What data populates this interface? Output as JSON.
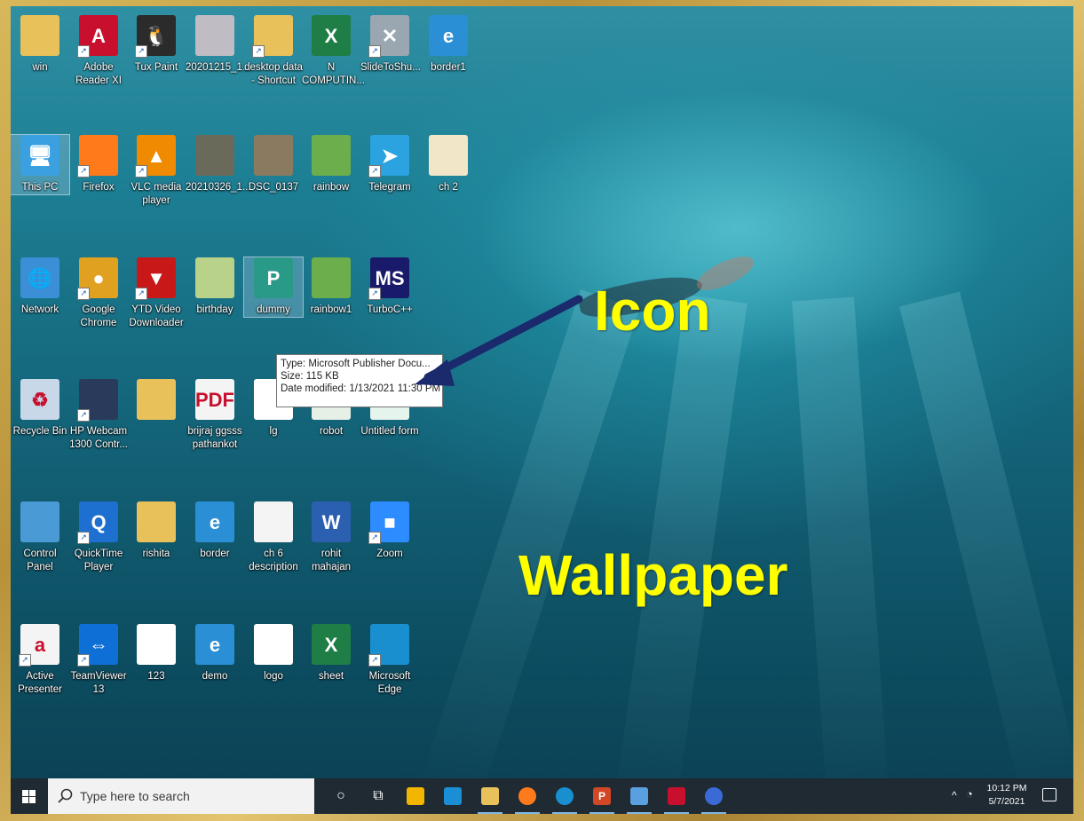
{
  "desktop": {
    "rows": [
      [
        {
          "name": "win-folder",
          "label": "win",
          "color": "#e8c15b",
          "glyph": "",
          "shortcut": false
        },
        {
          "name": "adobe-reader-xi",
          "label": "Adobe Reader XI",
          "color": "#c8102e",
          "glyph": "A",
          "shortcut": true
        },
        {
          "name": "tux-paint",
          "label": "Tux Paint",
          "color": "#2b2b2b",
          "glyph": "🐧",
          "shortcut": true
        },
        {
          "name": "image-20201215",
          "label": "20201215_1...",
          "color": "#bfbcc4",
          "glyph": "",
          "shortcut": false
        },
        {
          "name": "desktop-data-shortcut",
          "label": "desktop data - Shortcut",
          "color": "#e8c15b",
          "glyph": "",
          "shortcut": true
        },
        {
          "name": "n-computing",
          "label": "N COMPUTIN...",
          "color": "#1e7e45",
          "glyph": "X",
          "shortcut": false
        },
        {
          "name": "slidetoshutdown",
          "label": "SlideToShu...",
          "color": "#9aa6b0",
          "glyph": "✕",
          "shortcut": true
        },
        {
          "name": "border1",
          "label": "border1",
          "color": "#2b8fd6",
          "glyph": "e",
          "shortcut": false
        }
      ],
      [
        {
          "name": "this-pc",
          "label": "This PC",
          "color": "#3aa0e0",
          "glyph": "🖥",
          "shortcut": false,
          "selected": true
        },
        {
          "name": "firefox",
          "label": "Firefox",
          "color": "#ff7a1a",
          "glyph": "",
          "shortcut": true
        },
        {
          "name": "vlc-media-player",
          "label": "VLC media player",
          "color": "#f08a00",
          "glyph": "▲",
          "shortcut": true
        },
        {
          "name": "image-20210326",
          "label": "20210326_1...",
          "color": "#6a6a5a",
          "glyph": "",
          "shortcut": false
        },
        {
          "name": "dsc-0137",
          "label": "DSC_0137",
          "color": "#8a7a60",
          "glyph": "",
          "shortcut": false
        },
        {
          "name": "rainbow",
          "label": "rainbow",
          "color": "#6cae4c",
          "glyph": "",
          "shortcut": false
        },
        {
          "name": "telegram",
          "label": "Telegram",
          "color": "#2aa3e0",
          "glyph": "➤",
          "shortcut": true
        },
        {
          "name": "ch-2",
          "label": "ch 2",
          "color": "#f2e6c8",
          "glyph": "",
          "shortcut": false
        }
      ],
      [
        {
          "name": "network",
          "label": "Network",
          "color": "#3a8fd6",
          "glyph": "🌐",
          "shortcut": false
        },
        {
          "name": "google-chrome",
          "label": "Google Chrome",
          "color": "#e0a020",
          "glyph": "●",
          "shortcut": true
        },
        {
          "name": "ytd-video-downloader",
          "label": "YTD Video Downloader",
          "color": "#c81818",
          "glyph": "▼",
          "shortcut": true
        },
        {
          "name": "birthday",
          "label": "birthday",
          "color": "#b8d28a",
          "glyph": "",
          "shortcut": false
        },
        {
          "name": "dummy",
          "label": "dummy",
          "color": "#2a9a88",
          "glyph": "P",
          "shortcut": false,
          "selected": true
        },
        {
          "name": "rainbow1",
          "label": "rainbow1",
          "color": "#6cae4c",
          "glyph": "",
          "shortcut": false
        },
        {
          "name": "turboc",
          "label": "TurboC++",
          "color": "#1a1a6a",
          "glyph": "MS",
          "shortcut": true
        }
      ],
      [
        {
          "name": "recycle-bin",
          "label": "Recycle Bin",
          "color": "#c8d8e8",
          "glyph": "♻",
          "shortcut": false
        },
        {
          "name": "hp-webcam",
          "label": "HP Webcam 1300 Contr...",
          "color": "#2a3a5a",
          "glyph": "",
          "shortcut": true
        },
        {
          "name": "folder-blank",
          "label": "",
          "color": "#e8c15b",
          "glyph": "",
          "shortcut": false
        },
        {
          "name": "brijraj-ggsss-pathankot",
          "label": "brijraj ggsss pathankot",
          "color": "#f4f4f4",
          "glyph": "PDF",
          "shortcut": false
        },
        {
          "name": "lg",
          "label": "lg",
          "color": "#ffffff",
          "glyph": "",
          "shortcut": false
        },
        {
          "name": "robot",
          "label": "robot",
          "color": "#e6f0e6",
          "glyph": "",
          "shortcut": false
        },
        {
          "name": "untitled-form",
          "label": "Untitled form",
          "color": "#e6f4ee",
          "glyph": "a",
          "shortcut": false
        }
      ],
      [
        {
          "name": "control-panel",
          "label": "Control Panel",
          "color": "#4a9ad6",
          "glyph": "",
          "shortcut": false
        },
        {
          "name": "quicktime-player",
          "label": "QuickTime Player",
          "color": "#1d6fd0",
          "glyph": "Q",
          "shortcut": true
        },
        {
          "name": "rishita",
          "label": "rishita",
          "color": "#e8c15b",
          "glyph": "",
          "shortcut": false
        },
        {
          "name": "border",
          "label": "border",
          "color": "#2b8fd6",
          "glyph": "e",
          "shortcut": false
        },
        {
          "name": "ch-6-description",
          "label": "ch 6 description",
          "color": "#f4f4f4",
          "glyph": "",
          "shortcut": false
        },
        {
          "name": "rohit-mahajan",
          "label": "rohit mahajan",
          "color": "#2b5fb0",
          "glyph": "W",
          "shortcut": false
        },
        {
          "name": "zoom",
          "label": "Zoom",
          "color": "#2d8cff",
          "glyph": "■",
          "shortcut": true
        }
      ],
      [
        {
          "name": "active-presenter",
          "label": "Active Presenter",
          "color": "#f4f4f4",
          "glyph": "a",
          "shortcut": true
        },
        {
          "name": "teamviewer-13",
          "label": "TeamViewer 13",
          "color": "#0e6fd6",
          "glyph": "⇔",
          "shortcut": true
        },
        {
          "name": "file-123",
          "label": "123",
          "color": "#ffffff",
          "glyph": "",
          "shortcut": false
        },
        {
          "name": "demo",
          "label": "demo",
          "color": "#2b8fd6",
          "glyph": "e",
          "shortcut": false
        },
        {
          "name": "logo",
          "label": "logo",
          "color": "#ffffff",
          "glyph": "",
          "shortcut": false
        },
        {
          "name": "sheet",
          "label": "sheet",
          "color": "#1e7e45",
          "glyph": "X",
          "shortcut": false
        },
        {
          "name": "microsoft-edge",
          "label": "Microsoft Edge",
          "color": "#1a8fd0",
          "glyph": "",
          "shortcut": true
        }
      ]
    ]
  },
  "tooltip": {
    "type": "Type: Microsoft Publisher Docu...",
    "size": "Size: 115 KB",
    "modified": "Date modified: 1/13/2021 11:30 PM"
  },
  "annotations": {
    "icon_label": "Icon",
    "wallpaper_label": "Wallpaper",
    "arrow_color": "#1a2a6c",
    "text_color": "#ffff00"
  },
  "taskbar": {
    "search_placeholder": "Type here to search",
    "apps": [
      {
        "name": "cortana",
        "color": "#ffffff",
        "glyph": "○"
      },
      {
        "name": "task-view",
        "color": "#ffffff",
        "glyph": "⧉"
      },
      {
        "name": "microsoft-store",
        "color": "#f2b600",
        "glyph": ""
      },
      {
        "name": "mail",
        "color": "#1a8fd6",
        "glyph": ""
      },
      {
        "name": "file-explorer",
        "color": "#e8c15b",
        "glyph": ""
      },
      {
        "name": "firefox",
        "color": "#ff7a1a",
        "glyph": ""
      },
      {
        "name": "edge",
        "color": "#1a8fd0",
        "glyph": ""
      },
      {
        "name": "powerpoint",
        "color": "#d24726",
        "glyph": "P"
      },
      {
        "name": "paint",
        "color": "#5aa0e0",
        "glyph": ""
      },
      {
        "name": "app-red",
        "color": "#c8102e",
        "glyph": ""
      },
      {
        "name": "app-blue",
        "color": "#3a6ad6",
        "glyph": ""
      }
    ],
    "time": "10:12 PM",
    "date": "5/7/2021"
  }
}
